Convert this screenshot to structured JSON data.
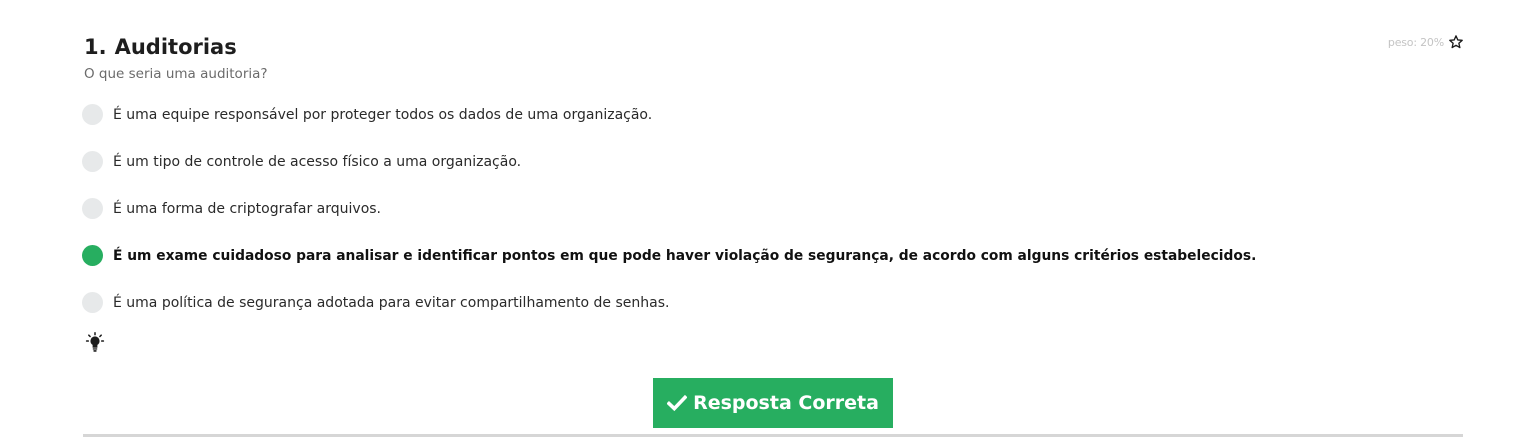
{
  "question": {
    "number": "1.",
    "title": "Auditorias",
    "prompt": "O que seria uma auditoria?",
    "weight_label": "peso: 20%",
    "options": [
      {
        "label": "É uma equipe responsável por proteger todos os dados de uma organização.",
        "selected": false
      },
      {
        "label": "É um tipo de controle de acesso físico a uma organização.",
        "selected": false
      },
      {
        "label": "É uma forma de criptografar arquivos.",
        "selected": false
      },
      {
        "label": "É um exame cuidadoso para analisar e identificar pontos em que pode haver violação de segurança, de acordo com alguns critérios estabelecidos.",
        "selected": true
      },
      {
        "label": "É uma política de segurança adotada para evitar compartilhamento de senhas.",
        "selected": false
      }
    ],
    "result_button": "Resposta Correta"
  },
  "icons": {
    "weight": "star-outline-icon",
    "hint": "lightbulb-icon",
    "result": "checkmark-icon"
  },
  "colors": {
    "correct": "#27ae60",
    "radio_unselected": "#e7e9ea",
    "title": "#1e1e1e",
    "muted": "#6b6b6b"
  }
}
